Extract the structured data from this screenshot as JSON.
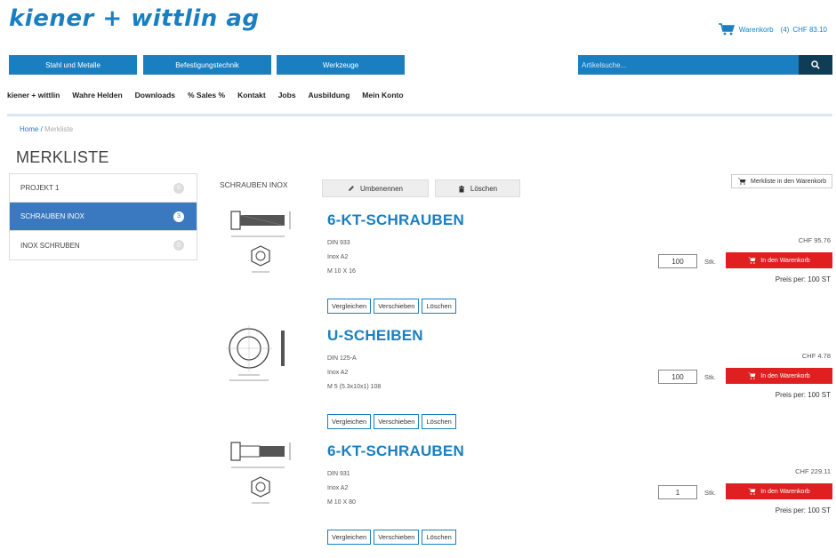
{
  "brand": {
    "logo": "kiener + wittlin ag"
  },
  "header": {
    "cart_label": "Warenkorb",
    "cart_count": "(4)",
    "cart_total": "CHF 83.10"
  },
  "mainnav": [
    "Stahl und Metalle",
    "Befestigungstechnik",
    "Werkzeuge"
  ],
  "search": {
    "placeholder": "Artikelsuche..."
  },
  "subnav": [
    "kiener + wittlin",
    "Wahre Helden",
    "Downloads",
    "% Sales %",
    "Kontakt",
    "Jobs",
    "Ausbildung",
    "Mein Konto"
  ],
  "breadcrumb": {
    "home": "Home",
    "separator": "/",
    "current": "Merkliste"
  },
  "page_title": "MERKLISTE",
  "lists": [
    {
      "label": "PROJEKT 1",
      "count": "0"
    },
    {
      "label": "SCHRAUBEN INOX",
      "count": "3",
      "active": true
    },
    {
      "label": "INOX SCHRUBEN",
      "count": "0"
    }
  ],
  "current_list": {
    "title": "SCHRAUBEN INOX",
    "rename_label": "Umbenennen",
    "delete_label": "Löschen",
    "add_all_label": "Merkliste in den Warenkorb"
  },
  "item_actions": {
    "compare": "Vergleichen",
    "move": "Verschieben",
    "delete": "Löschen"
  },
  "cart_button_label": "In den Warenkorb",
  "unit_label": "Stk.",
  "per_price_label": "Preis per:",
  "items": [
    {
      "name": "6-KT-SCHRAUBEN",
      "spec1": "DIN 933",
      "spec2": "Inox A2",
      "spec3": "M 10 X 16",
      "price": "CHF 95.76",
      "qty": "100",
      "per": "100 ST",
      "drawing": "hex-bolt"
    },
    {
      "name": "U-SCHEIBEN",
      "spec1": "DIN 125-A",
      "spec2": "Inox A2",
      "spec3": "M 5 (5.3x10x1) 108",
      "price": "CHF 4.78",
      "qty": "100",
      "per": "100 ST",
      "drawing": "washer"
    },
    {
      "name": "6-KT-SCHRAUBEN",
      "spec1": "DIN 931",
      "spec2": "Inox A2",
      "spec3": "M 10 X 80",
      "price": "CHF 229.11",
      "qty": "1",
      "per": "100 ST",
      "drawing": "hex-bolt"
    }
  ],
  "colors": {
    "brand_blue": "#1a7fc1",
    "dark_navy": "#0f3d55",
    "active_blue": "#3a78c0",
    "cart_red": "#e02020"
  }
}
